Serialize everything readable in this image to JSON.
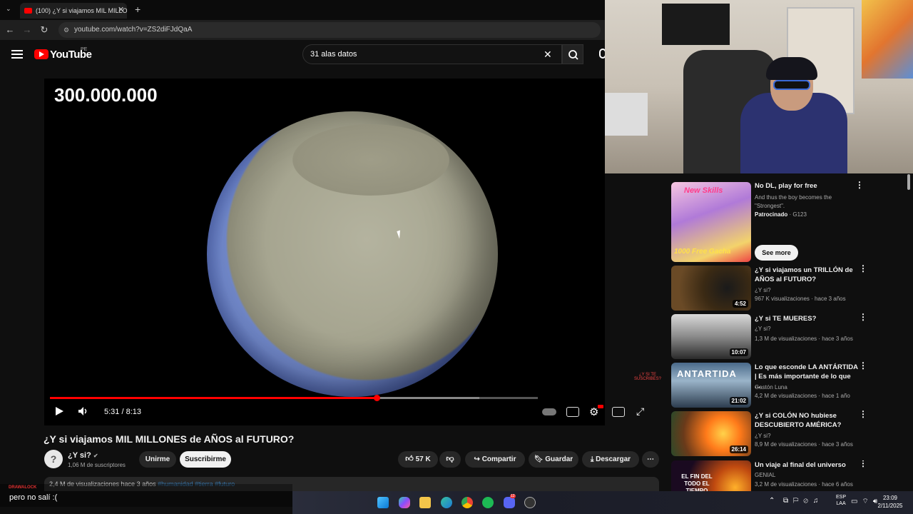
{
  "browser": {
    "tab_title": "(100) ¿Y si viajamos MIL MILLO",
    "url": "youtube.com/watch?v=ZS2diFJdQaA"
  },
  "youtube": {
    "logo_text": "YouTube",
    "country_code": "PE",
    "search_value": "31 alas datos"
  },
  "player": {
    "overlay_number": "300.000.000",
    "watermark": "¿Y SI TE SUSCRIBES?",
    "time": "5:31 / 8:13",
    "progress": 0.67,
    "buffered": 0.88
  },
  "video": {
    "title": "¿Y si viajamos MIL MILLONES de AÑOS al FUTURO?",
    "channel": "¿Y si?",
    "subscribers": "1,06 M de suscriptores",
    "join_label": "Unirme",
    "subscribe_label": "Suscribirme",
    "likes": "57 K",
    "share_label": "Compartir",
    "save_label": "Guardar",
    "download_label": "Descargar",
    "views_date": "2,4 M de visualizaciones  hace 3 años",
    "hashtags": "#humanidad #tierra #futuro"
  },
  "ad": {
    "title": "No DL, play for free",
    "description": "And thus the boy becomes the \"Strongest\".",
    "sponsor": "Patrocinado",
    "sponsor_name": "G123",
    "see_more": "See more",
    "thumb_text_top": "New Skills",
    "thumb_text_bottom": "1000 Free Gacha"
  },
  "recommendations": [
    {
      "title": "¿Y si viajamos un TRILLÓN de AÑOS al FUTURO?",
      "channel": "¿Y si?",
      "meta": "967 K visualizaciones · hace 3 años",
      "duration": "4:52"
    },
    {
      "title": "¿Y si TE MUERES?",
      "channel": "¿Y si?",
      "meta": "1,3 M de visualizaciones · hace 3 años",
      "duration": "10:07"
    },
    {
      "title": "Lo que esconde LA ANTÁRTIDA | Es más importante de lo que ...",
      "channel": "Gastón Luna",
      "meta": "4,2 M de visualizaciones · hace 1 año",
      "duration": "21:02",
      "thumb_text": "ANTARTIDA"
    },
    {
      "title": "¿Y si COLÓN NO hubiese DESCUBIERTO AMÉRICA?",
      "channel": "¿Y si?",
      "meta": "8,9 M de visualizaciones · hace 3 años",
      "duration": "26:14"
    },
    {
      "title": "Un viaje al final del universo",
      "channel": "GENIAL",
      "meta": "3,2 M de visualizaciones · hace 6 años",
      "duration": "",
      "thumb_text": "EL FIN DEL TODO EL TIEMPO"
    }
  ],
  "chat": {
    "username": "DRAWALOCK",
    "message": "pero no salí :("
  },
  "taskbar": {
    "lang_top": "ESP",
    "lang_bottom": "LAA",
    "time": "23:09",
    "date": "2/11/2025",
    "badge": "12"
  },
  "colors": {
    "youtube_red": "#ff0000",
    "background": "#0f0f0f",
    "link_blue": "#3ea6ff"
  }
}
